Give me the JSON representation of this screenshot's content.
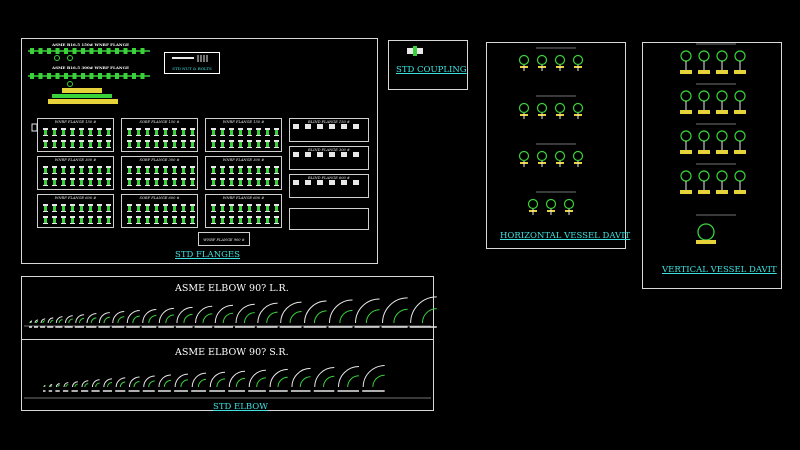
{
  "colors": {
    "frame": "#d8d8d8",
    "title": "#3fe0e0",
    "drawing_green": "#3ad23a",
    "drawing_white": "#e8e8e8",
    "drawing_yellow": "#e6d33a"
  },
  "flanges": {
    "title": "STD FLANGES",
    "header_150": "ASME B16.5 150# WNRF FLANGE",
    "header_300": "ASME B16.5 300# WNRF FLANGE",
    "nut_bolts": "STD NUT & BOLTS",
    "groups": [
      {
        "label": "WNRF FLANGE 150 #"
      },
      {
        "label": "SORF FLANGE 150 #"
      },
      {
        "label": "WNRF FLANGE 150 #"
      },
      {
        "label": "WNRF FLANGE 300 #"
      },
      {
        "label": "SORF FLANGE 300 #"
      },
      {
        "label": "WNRF FLANGE 300 #"
      },
      {
        "label": "WNRF FLANGE 600 #"
      },
      {
        "label": "SORF FLANGE 600 #"
      },
      {
        "label": "WNRF FLANGE 600 #"
      }
    ],
    "blind_groups": [
      {
        "label": "BLIND FLANGE 150 #"
      },
      {
        "label": "BLIND FLANGE 300 #"
      },
      {
        "label": "BLIND FLANGE 600 #"
      }
    ],
    "bottom_label": "WNRF FLANGE 900 #"
  },
  "coupling": {
    "title": "STD COUPLING"
  },
  "horizontal_davit": {
    "title": "HORIZONTAL VESSEL DAVIT"
  },
  "vertical_davit": {
    "title": "VERTICAL VESSEL DAVIT"
  },
  "elbow": {
    "title": "STD ELBOW",
    "lr_title": "ASME ELBOW 90? L.R.",
    "sr_title": "ASME ELBOW 90? S.R."
  }
}
